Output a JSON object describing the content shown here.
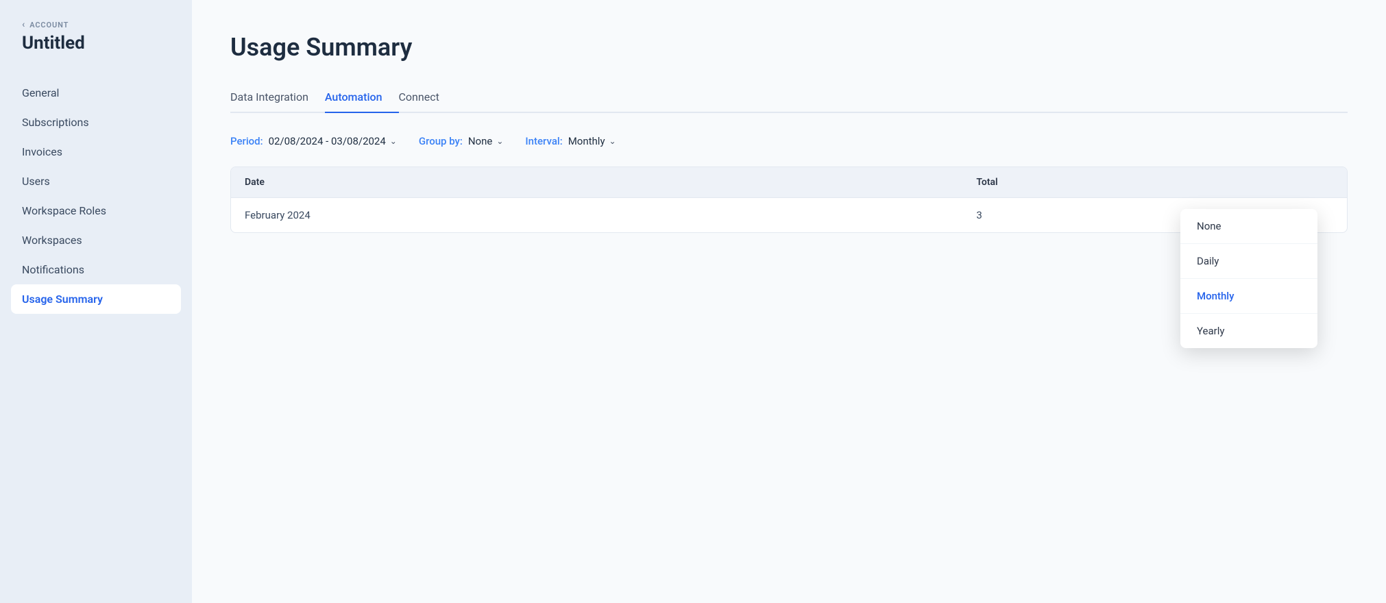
{
  "sidebar": {
    "account_label": "ACCOUNT",
    "account_name": "Untitled",
    "nav_items": [
      {
        "id": "general",
        "label": "General",
        "active": false
      },
      {
        "id": "subscriptions",
        "label": "Subscriptions",
        "active": false
      },
      {
        "id": "invoices",
        "label": "Invoices",
        "active": false
      },
      {
        "id": "users",
        "label": "Users",
        "active": false
      },
      {
        "id": "workspace-roles",
        "label": "Workspace Roles",
        "active": false
      },
      {
        "id": "workspaces",
        "label": "Workspaces",
        "active": false
      },
      {
        "id": "notifications",
        "label": "Notifications",
        "active": false
      },
      {
        "id": "usage-summary",
        "label": "Usage Summary",
        "active": true
      }
    ]
  },
  "main": {
    "page_title": "Usage Summary",
    "tabs": [
      {
        "id": "data-integration",
        "label": "Data Integration",
        "active": false
      },
      {
        "id": "automation",
        "label": "Automation",
        "active": true
      },
      {
        "id": "connect",
        "label": "Connect",
        "active": false
      }
    ],
    "filters": {
      "period_label": "Period:",
      "period_value": "02/08/2024 - 03/08/2024",
      "group_by_label": "Group by:",
      "group_by_value": "None",
      "interval_label": "Interval:",
      "interval_value": "Monthly"
    },
    "table": {
      "columns": [
        "Date",
        "Total"
      ],
      "rows": [
        {
          "date": "February 2024",
          "total": "3"
        }
      ]
    },
    "interval_dropdown": {
      "options": [
        {
          "id": "none",
          "label": "None",
          "selected": false
        },
        {
          "id": "daily",
          "label": "Daily",
          "selected": false
        },
        {
          "id": "monthly",
          "label": "Monthly",
          "selected": true
        },
        {
          "id": "yearly",
          "label": "Yearly",
          "selected": false
        }
      ]
    }
  }
}
